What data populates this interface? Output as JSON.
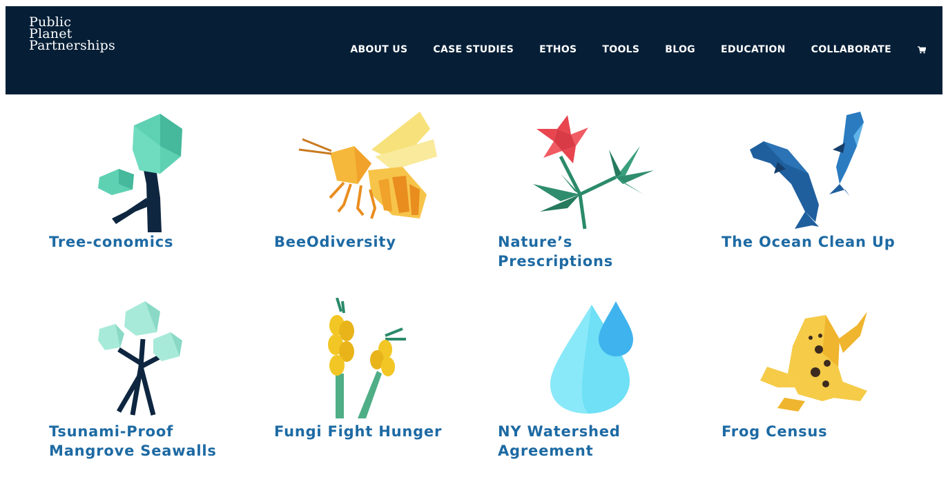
{
  "brand": {
    "name_lines": [
      "Public",
      "Planet",
      "Partnerships"
    ],
    "background_color": "#061f37"
  },
  "nav": {
    "items": [
      {
        "label": "ABOUT US"
      },
      {
        "label": "CASE STUDIES"
      },
      {
        "label": "ETHOS"
      },
      {
        "label": "TOOLS"
      },
      {
        "label": "BLOG"
      },
      {
        "label": "EDUCATION"
      },
      {
        "label": "COLLABORATE"
      }
    ],
    "cart_icon": "shopping-cart-icon"
  },
  "projects": {
    "title_color": "#1d6aa3",
    "items": [
      {
        "title": "Tree-conomics",
        "icon": "tree-icon"
      },
      {
        "title": "BeeOdiversity",
        "icon": "bee-icon"
      },
      {
        "title": "Nature’s Prescriptions",
        "icon": "flower-icon"
      },
      {
        "title": "The Ocean Clean Up",
        "icon": "dolphin-icon"
      },
      {
        "title": "Tsunami-Proof Mangrove Seawalls",
        "icon": "mangrove-icon"
      },
      {
        "title": "Fungi Fight Hunger",
        "icon": "wheat-icon"
      },
      {
        "title": "NY Watershed Agreement",
        "icon": "water-drop-icon"
      },
      {
        "title": "Frog Census",
        "icon": "frog-icon"
      }
    ]
  }
}
